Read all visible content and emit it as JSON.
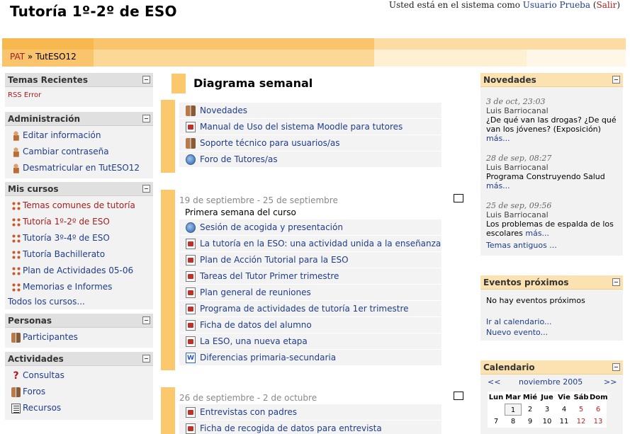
{
  "header": {
    "site_title": "Tutoría 1º-2º de ESO",
    "login_prefix": "Usted está en el sistema como ",
    "user_name": "Usuario Prueba",
    "logout_open": " (",
    "logout_label": "Salir",
    "logout_close": ")"
  },
  "breadcrumb": {
    "root": "PAT",
    "separator": " » ",
    "current": "TutESO12"
  },
  "left": {
    "recent": {
      "title": "Temas Recientes",
      "rss": "RSS Error"
    },
    "admin": {
      "title": "Administración",
      "items": [
        {
          "label": "Editar información",
          "icon": "person-edit-icon"
        },
        {
          "label": "Cambiar contraseña",
          "icon": "person-key-icon"
        },
        {
          "label": "Desmatricular en TutESO12",
          "icon": "person-remove-icon"
        }
      ]
    },
    "courses": {
      "title": "Mis cursos",
      "items": [
        {
          "label": "Temas comunes de tutoría",
          "color": "#a31f1f"
        },
        {
          "label": "Tutoría 1º-2º de ESO",
          "color": "#a31f1f"
        },
        {
          "label": "Tutoría 3º-4º de ESO",
          "color": "#1f3d8c"
        },
        {
          "label": "Tutoría Bachillerato",
          "color": "#1f3d8c"
        },
        {
          "label": "Plan de Actividades 05-06",
          "color": "#1f3d8c"
        },
        {
          "label": "Memorias e Informes",
          "color": "#1f3d8c"
        }
      ],
      "all": "Todos los cursos..."
    },
    "people": {
      "title": "Personas",
      "items": [
        {
          "label": "Participantes"
        }
      ]
    },
    "activities": {
      "title": "Actividades",
      "items": [
        {
          "label": "Consultas",
          "icon": "question-icon"
        },
        {
          "label": "Foros",
          "icon": "forum-icon"
        },
        {
          "label": "Recursos",
          "icon": "resource-icon"
        }
      ]
    }
  },
  "center": {
    "title": "Diagrama semanal",
    "section0": [
      {
        "label": "Novedades",
        "icon": "forum-icon"
      },
      {
        "label": "Manual de Uso del sistema Moodle para tutores",
        "icon": "pdf-icon"
      },
      {
        "label": "Soporte técnico para usuarios/as",
        "icon": "forum-icon"
      },
      {
        "label": "Foro de Tutores/as",
        "icon": "globe-icon"
      }
    ],
    "week1": {
      "date": "19 de septiembre - 25 de septiembre",
      "summary": "Primera semana del curso",
      "items": [
        {
          "label": "Sesión de acogida y presentación",
          "icon": "globe-doc-icon"
        },
        {
          "label": "La tutoría en la ESO: una actividad unida a la enseñanza",
          "icon": "pdf-icon"
        },
        {
          "label": "Plan de Acción Tutorial para la ESO",
          "icon": "pdf-icon"
        },
        {
          "label": "Tareas del Tutor Primer trimestre",
          "icon": "pdf-icon"
        },
        {
          "label": "Plan general de reuniones",
          "icon": "pdf-icon"
        },
        {
          "label": "Programa de actividades de tutoría 1er trimestre",
          "icon": "pdf-icon"
        },
        {
          "label": "Ficha de datos del alumno",
          "icon": "pdf-icon"
        },
        {
          "label": "La ESO, una nueva etapa",
          "icon": "pdf-icon"
        },
        {
          "label": "Diferencias primaria-secundaria",
          "icon": "word-icon"
        }
      ]
    },
    "week2": {
      "date": "26 de septiembre - 2 de octubre",
      "items": [
        {
          "label": "Entrevistas con padres",
          "icon": "pdf-icon"
        },
        {
          "label": "Ficha de recogida de datos para entrevista",
          "icon": "pdf-icon"
        }
      ]
    }
  },
  "right": {
    "news": {
      "title": "Novedades",
      "entries": [
        {
          "date": "3 de oct, 23:03",
          "author": "Luis Barriocanal",
          "text": "¿De qué van las drogas? ¿De qué van los jóvenes? (Exposición)",
          "more": "más..."
        },
        {
          "date": "28 de sep, 08:27",
          "author": "Luis Barriocanal",
          "text": "Programa Construyendo Salud",
          "more": "más..."
        },
        {
          "date": "25 de sep, 09:56",
          "author": "Luis Barriocanal",
          "text": "Los problemas de espalda de los escolares",
          "more": "más..."
        }
      ],
      "older": "Temas antiguos ..."
    },
    "events": {
      "title": "Eventos próximos",
      "none": "No hay eventos próximos",
      "calendar_link": "Ir al calendario...",
      "new_event": "Nuevo evento..."
    },
    "calendar": {
      "title": "Calendario",
      "prev": "<<",
      "month": "noviembre 2005",
      "next": ">>",
      "days": [
        "Lun",
        "Mar",
        "Mié",
        "Jue",
        "Vie",
        "Sáb",
        "Dom"
      ],
      "week1": [
        "",
        "1",
        "2",
        "3",
        "4",
        "5",
        "6"
      ],
      "week2": [
        "7",
        "8",
        "9",
        "10",
        "11",
        "12",
        "13"
      ]
    }
  }
}
